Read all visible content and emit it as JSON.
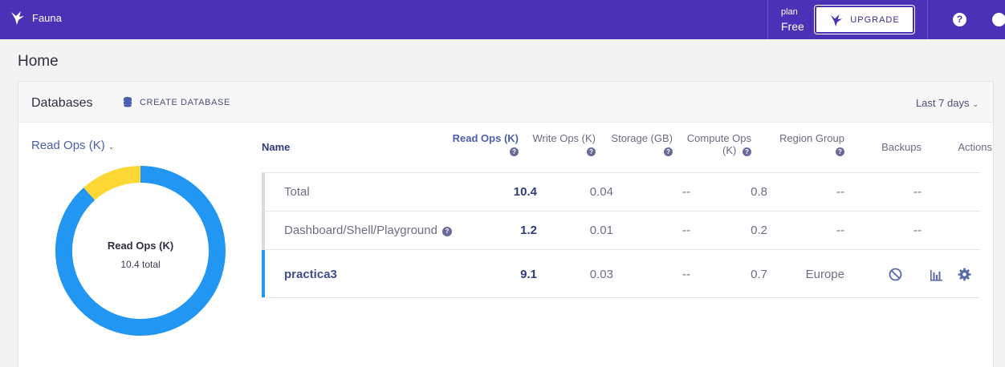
{
  "topbar": {
    "app_name": "Fauna",
    "plan_label": "plan",
    "plan_value": "Free",
    "upgrade_label": "UPGRADE",
    "help_glyph": "?"
  },
  "page": {
    "title": "Home"
  },
  "databases_card": {
    "title": "Databases",
    "create_label": "CREATE DATABASE",
    "time_range": "Last 7 days"
  },
  "chart": {
    "metric_label": "Read Ops (K)",
    "center_title": "Read Ops (K)",
    "center_subtitle": "10.4 total"
  },
  "chart_data": {
    "type": "pie",
    "categories": [
      "practica3",
      "Dashboard/Shell/Playground"
    ],
    "values": [
      9.1,
      1.2
    ],
    "colors": [
      "#2196f3",
      "#fdd835"
    ],
    "total": 10.4
  },
  "table": {
    "columns": {
      "name": "Name",
      "read_ops": "Read Ops (K)",
      "write_ops": "Write Ops (K)",
      "storage": "Storage (GB)",
      "compute_ops_1": "Compute Ops",
      "compute_ops_2": "(K)",
      "region": "Region Group",
      "backups": "Backups",
      "actions": "Actions"
    },
    "rows": [
      {
        "name": "Total",
        "read": "10.4",
        "write": "0.04",
        "storage": "--",
        "compute": "0.8",
        "region": "--",
        "backups": "--"
      },
      {
        "name": "Dashboard/Shell/Playground",
        "read": "1.2",
        "write": "0.01",
        "storage": "--",
        "compute": "0.2",
        "region": "--",
        "backups": "--"
      },
      {
        "name": "practica3",
        "read": "9.1",
        "write": "0.03",
        "storage": "--",
        "compute": "0.7",
        "region": "Europe"
      }
    ],
    "help_glyph": "?"
  },
  "colors": {
    "brand": "#4b31b5",
    "series_primary": "#2196f3",
    "series_secondary": "#fdd835",
    "row_highlight": "#2196f3"
  },
  "icons": {
    "logo": "fauna-bird-icon",
    "create": "database-icon",
    "backups": "disabled-icon",
    "actions": [
      "bar-chart-icon",
      "gear-icon"
    ]
  }
}
